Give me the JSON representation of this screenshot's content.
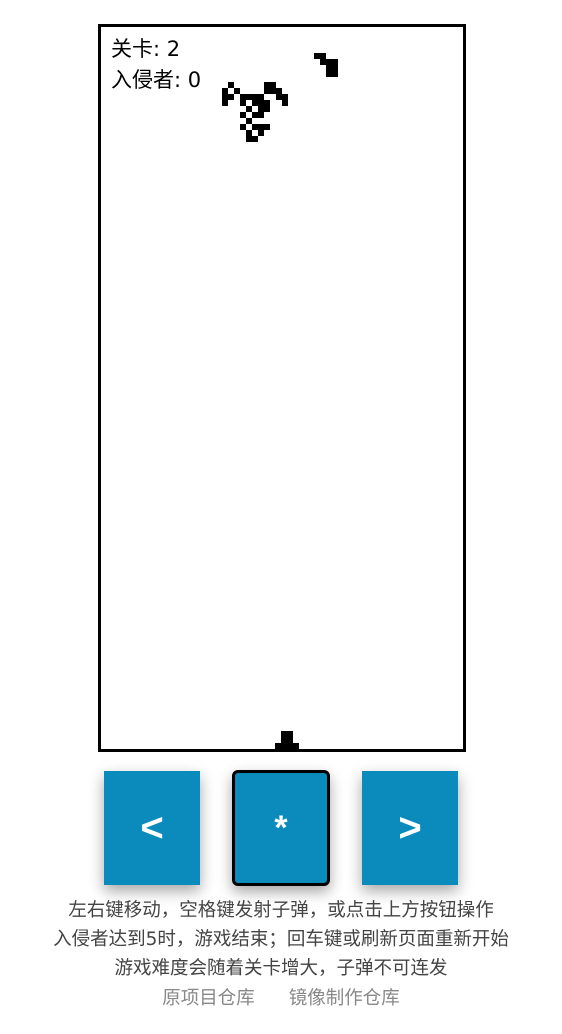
{
  "hud": {
    "level_text": "关卡: 2",
    "invaders_text": "入侵者: 0"
  },
  "controls": {
    "left_label": "<",
    "fire_label": "*",
    "right_label": ">",
    "accent_color": "#0a8bbc"
  },
  "instructions": [
    "左右键移动，空格键发射子弹，或点击上方按钮操作",
    "入侵者达到5时，游戏结束；回车键或刷新页面重新开始",
    "游戏难度会随着关卡增大，子弹不可连发"
  ],
  "links": {
    "original_repo": "原项目仓库",
    "mirror_repo": "镜像制作仓库"
  },
  "icons": {
    "left": "chevron-left-glyph",
    "fire": "asterisk-glyph",
    "right": "chevron-right-glyph",
    "invader": "pixel-invader",
    "player": "pixel-cannon"
  }
}
